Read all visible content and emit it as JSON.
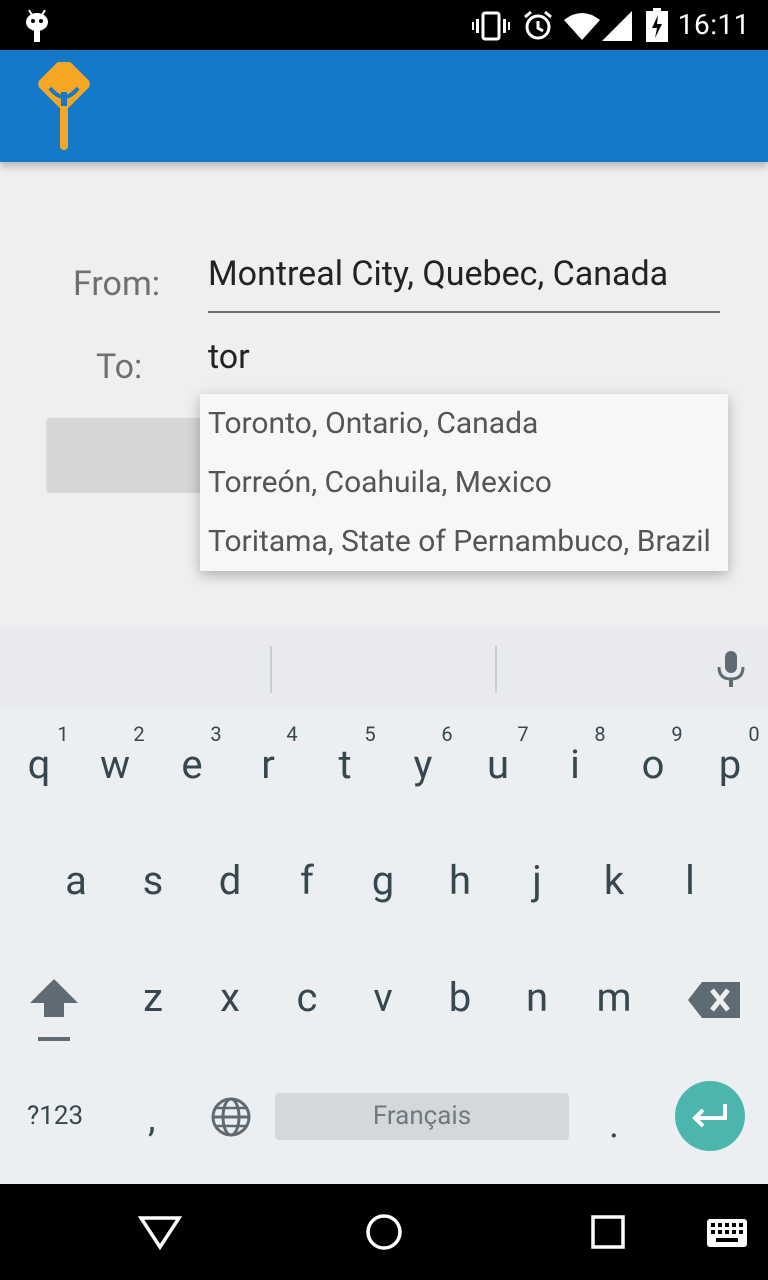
{
  "status_bar": {
    "time": "16:11"
  },
  "form": {
    "from_label": "From:",
    "from_value": "Montreal City, Quebec, Canada",
    "to_label": "To:",
    "to_value": "tor"
  },
  "suggestions": [
    "Toronto, Ontario, Canada",
    "Torreón, Coahuila, Mexico",
    "Toritama, State of Pernambuco, Brazil"
  ],
  "keyboard": {
    "row1": [
      "q",
      "w",
      "e",
      "r",
      "t",
      "y",
      "u",
      "i",
      "o",
      "p"
    ],
    "row1_hints": [
      "1",
      "2",
      "3",
      "4",
      "5",
      "6",
      "7",
      "8",
      "9",
      "0"
    ],
    "row2": [
      "a",
      "s",
      "d",
      "f",
      "g",
      "h",
      "j",
      "k",
      "l"
    ],
    "row3": [
      "z",
      "x",
      "c",
      "v",
      "b",
      "n",
      "m"
    ],
    "symbols_key": "?123",
    "comma_key": ",",
    "space_label": "Français",
    "period_key": "."
  },
  "colors": {
    "app_bar": "#1479c9",
    "logo": "#f5a623",
    "enter_key": "#4db6ac"
  }
}
